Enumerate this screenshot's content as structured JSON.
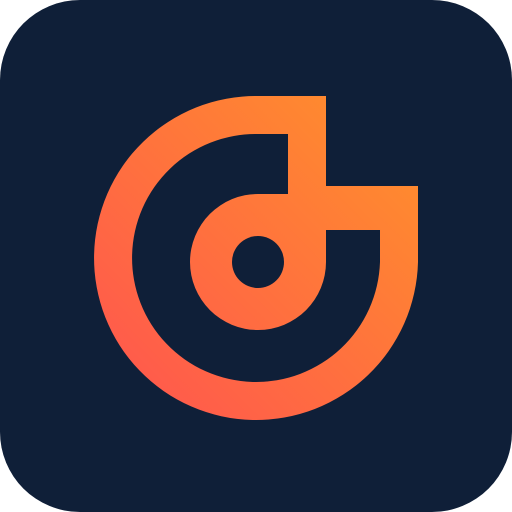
{
  "icon": {
    "name": "app-logo-icon",
    "background_color": "#0F1F38",
    "gradient_start_color": "#FF5350",
    "gradient_end_color": "#FF922A",
    "shape": "rounded-square"
  }
}
